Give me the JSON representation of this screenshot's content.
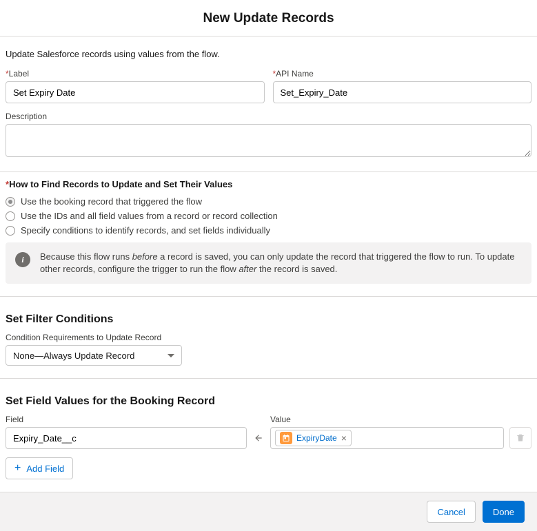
{
  "modal": {
    "title": "New Update Records"
  },
  "intro": "Update Salesforce records using values from the flow.",
  "labels": {
    "label": "Label",
    "apiName": "API Name",
    "description": "Description"
  },
  "fields": {
    "label": "Set Expiry Date",
    "apiName": "Set_Expiry_Date",
    "description": ""
  },
  "find": {
    "heading": "How to Find Records to Update and Set Their Values",
    "options": [
      "Use the booking record that triggered the flow",
      "Use the IDs and all field values from a record or record collection",
      "Specify conditions to identify records, and set fields individually"
    ],
    "selectedIndex": 0
  },
  "info": {
    "pre": "Because this flow runs ",
    "em1": "before",
    "mid": " a record is saved, you can only update the record that triggered the flow to run. To update other records, configure the trigger to run the flow ",
    "em2": "after",
    "post": " the record is saved."
  },
  "filter": {
    "heading": "Set Filter Conditions",
    "label": "Condition Requirements to Update Record",
    "selected": "None—Always Update Record"
  },
  "setValues": {
    "heading": "Set Field Values for the Booking Record",
    "fieldLabel": "Field",
    "valueLabel": "Value",
    "rows": [
      {
        "field": "Expiry_Date__c",
        "valuePill": "ExpiryDate"
      }
    ],
    "addField": "Add Field"
  },
  "footer": {
    "cancel": "Cancel",
    "done": "Done"
  }
}
